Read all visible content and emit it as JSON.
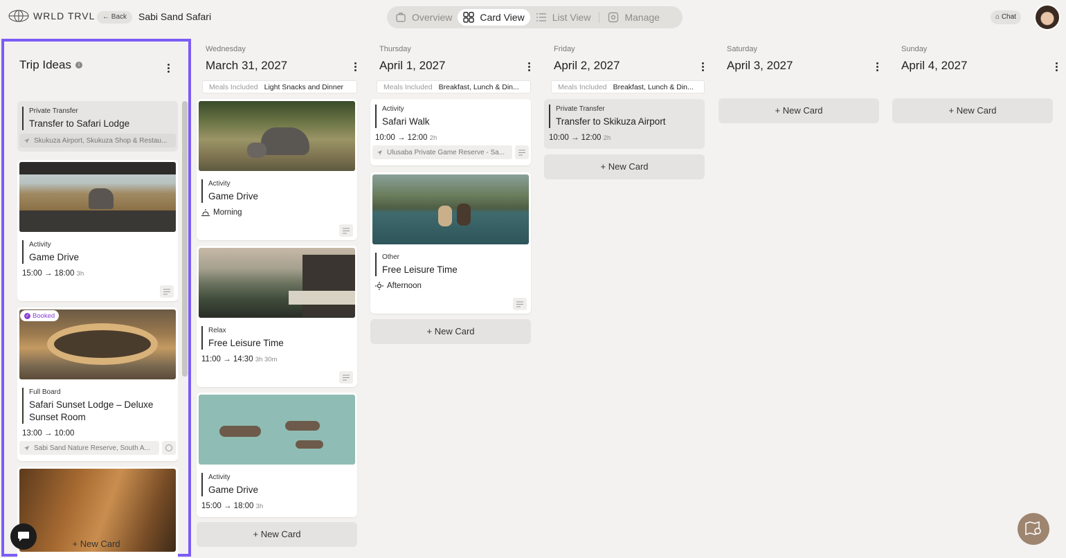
{
  "app": {
    "logo_text": "WRLD TRVL",
    "back_label": "Back",
    "trip_title": "Sabi Sand Safari",
    "chat_label": "Chat"
  },
  "tabs": [
    {
      "label": "Overview",
      "icon": "suitcase-icon",
      "active": false
    },
    {
      "label": "Card View",
      "icon": "grid-icon",
      "active": true
    },
    {
      "label": "List View",
      "icon": "list-icon",
      "active": false
    },
    {
      "label": "Manage",
      "icon": "gear-icon",
      "active": false
    }
  ],
  "ideas": {
    "title": "Trip Ideas",
    "new_card": "+ New Card",
    "cards": [
      {
        "type": "Private Transfer",
        "title": "Transfer to Safari Lodge",
        "location": "Skukuza Airport, Skukuza Shop & Restau..."
      },
      {
        "type": "Activity",
        "title": "Game Drive",
        "time": "15:00 → 18:00",
        "duration": "3h"
      },
      {
        "badge": "Booked",
        "type": "Full Board",
        "title": "Safari Sunset Lodge – Deluxe Sunset Room",
        "time": "13:00 → 10:00",
        "location": "Sabi Sand Nature Reserve, South A..."
      }
    ]
  },
  "days": [
    {
      "day": "Wednesday",
      "date": "March 31, 2027",
      "meals_label": "Meals Included",
      "meals_value": "Light Snacks and Dinner",
      "new_card": "+ New Card",
      "cards": [
        {
          "type": "Activity",
          "title": "Game Drive",
          "slot": "Morning"
        },
        {
          "type": "Relax",
          "title": "Free Leisure Time",
          "time": "11:00 → 14:30",
          "duration": "3h 30m"
        },
        {
          "type": "Activity",
          "title": "Game Drive",
          "time": "15:00 → 18:00",
          "duration": "3h"
        }
      ]
    },
    {
      "day": "Thursday",
      "date": "April 1, 2027",
      "meals_label": "Meals Included",
      "meals_value": "Breakfast, Lunch & Din...",
      "new_card": "+ New Card",
      "cards": [
        {
          "type": "Activity",
          "title": "Safari Walk",
          "time": "10:00 → 12:00",
          "duration": "2h",
          "location": "Ulusaba Private Game Reserve - Sa..."
        },
        {
          "type": "Other",
          "title": "Free Leisure Time",
          "slot": "Afternoon"
        }
      ]
    },
    {
      "day": "Friday",
      "date": "April 2, 2027",
      "meals_label": "Meals Included",
      "meals_value": "Breakfast, Lunch & Din...",
      "new_card": "+ New Card",
      "cards": [
        {
          "type": "Private Transfer",
          "title": "Transfer to Skikuza Airport",
          "time": "10:00 → 12:00",
          "duration": "2h"
        }
      ]
    },
    {
      "day": "Saturday",
      "date": "April 3, 2027",
      "new_card": "+ New Card"
    },
    {
      "day": "Sunday",
      "date": "April 4, 2027",
      "new_card": "+ New Card"
    }
  ],
  "colors": {
    "accent": "#7c5cf6",
    "booked": "#8b3fd6",
    "background": "#f3f2f0"
  }
}
